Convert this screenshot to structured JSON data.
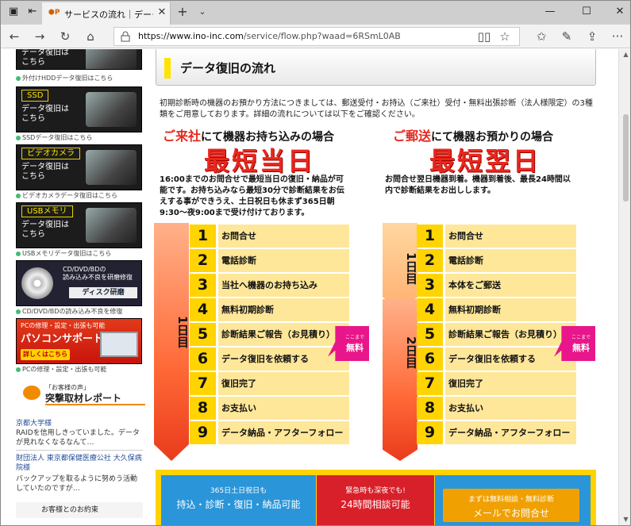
{
  "browser": {
    "tab_title": "サービスの流れ｜データ復旧",
    "url_prefix": "https://www.ino-inc.com",
    "url_path": "/service/flow.php?waad=6RSmL0AB"
  },
  "sidebar": {
    "banner0_sub": "データ復旧は\nこちら",
    "cap0": "外付けHDDデータ復旧はこちら",
    "banner1_hdr": "SSD",
    "banner1_sub": "データ復旧は\nこちら",
    "cap1": "SSDデータ復旧はこちら",
    "banner2_hdr": "ビデオカメラ",
    "banner2_sub": "データ復旧は\nこちら",
    "cap2": "ビデオカメラデータ復旧はこちら",
    "banner3_hdr": "USBメモリ",
    "banner3_sub": "データ復旧は\nこちら",
    "cap3": "USBメモリデータ復旧はこちら",
    "disc_t1": "CD/DVD/BDの\n読み込み不良を研磨修復",
    "disc_t2": "ディスク研磨",
    "cap4": "CD/DVD/BDの読み込み不良を修復",
    "pc_t1": "PCの修理・設定・出張も可能",
    "pc_t2": "パソコンサポート",
    "pc_t3": "詳しくはこちら",
    "cap5": "PCの修理・設定・出張も可能",
    "report_small": "「お客様の声」",
    "report_title": "突撃取材レポート",
    "r1_name": "京都大学様",
    "r1_text": "RAIDを信用しきっていました。データが見れなくなるなんて…",
    "r2_name": "財団法人 東京都保健医療公社 大久保病院様",
    "r2_text": "バックアップを取るように努めう活動していたのですが…",
    "promise": "お客様とのお約束"
  },
  "main": {
    "section_title": "データ復旧の流れ",
    "intro": "初期診断時の機器のお預かり方法につきましては、郵送受付・お持込（ご来社）受付・無料出張診断（法人様限定）の3種類をご用意しております。詳細の流れについては以下をご確認ください。",
    "left": {
      "head_red": "ご来社",
      "head_rest": "にて機器お持ち込みの場合",
      "big": "最短当日",
      "desc": "16:00までのお問合せで最短当日の復旧・納品が可能です。お持ち込みなら最短30分で診断結果をお伝えする事ができうえ、土日祝日も休まず365日朝9:30～夜9:00まで受け付けております。",
      "arrow": "1日目",
      "steps": [
        {
          "n": "1",
          "t": "お問合せ"
        },
        {
          "n": "2",
          "t": "電話診断"
        },
        {
          "n": "3",
          "t": "当社へ機器のお持ち込み"
        },
        {
          "n": "4",
          "t": "無料初期診断"
        },
        {
          "n": "5",
          "t": "診断結果ご報告（お見積り）"
        },
        {
          "n": "6",
          "t": "データ復旧を依頼する"
        },
        {
          "n": "7",
          "t": "復旧完了"
        },
        {
          "n": "8",
          "t": "お支払い"
        },
        {
          "n": "9",
          "t": "データ納品・アフターフォロー"
        }
      ]
    },
    "right": {
      "head_red": "ご郵送",
      "head_rest": "にて機器お預かりの場合",
      "big": "最短翌日",
      "desc": "お問合せ翌日機器到着。機器到着後、最長24時間以内で診断結果をお出しします。",
      "arrow1": "1日目",
      "arrow2": "2日目",
      "steps": [
        {
          "n": "1",
          "t": "お問合せ"
        },
        {
          "n": "2",
          "t": "電話診断"
        },
        {
          "n": "3",
          "t": "本体をご郵送"
        },
        {
          "n": "4",
          "t": "無料初期診断"
        },
        {
          "n": "5",
          "t": "診断結果ご報告（お見積り）"
        },
        {
          "n": "6",
          "t": "データ復旧を依頼する"
        },
        {
          "n": "7",
          "t": "復旧完了"
        },
        {
          "n": "8",
          "t": "お支払い"
        },
        {
          "n": "9",
          "t": "データ納品・アフターフォロー"
        }
      ]
    },
    "free_small": "ここまで",
    "free_big": "無料",
    "contact": {
      "b1_top": "365日土日祝日も",
      "b1_main": "持込・診断・復旧・納品可能",
      "b2_top": "緊急時も深夜でも!",
      "b2_main": "24時間相談可能",
      "b3_top": "まずは無料相談・無料診断",
      "b3_main": "メールでお問合せ"
    }
  }
}
